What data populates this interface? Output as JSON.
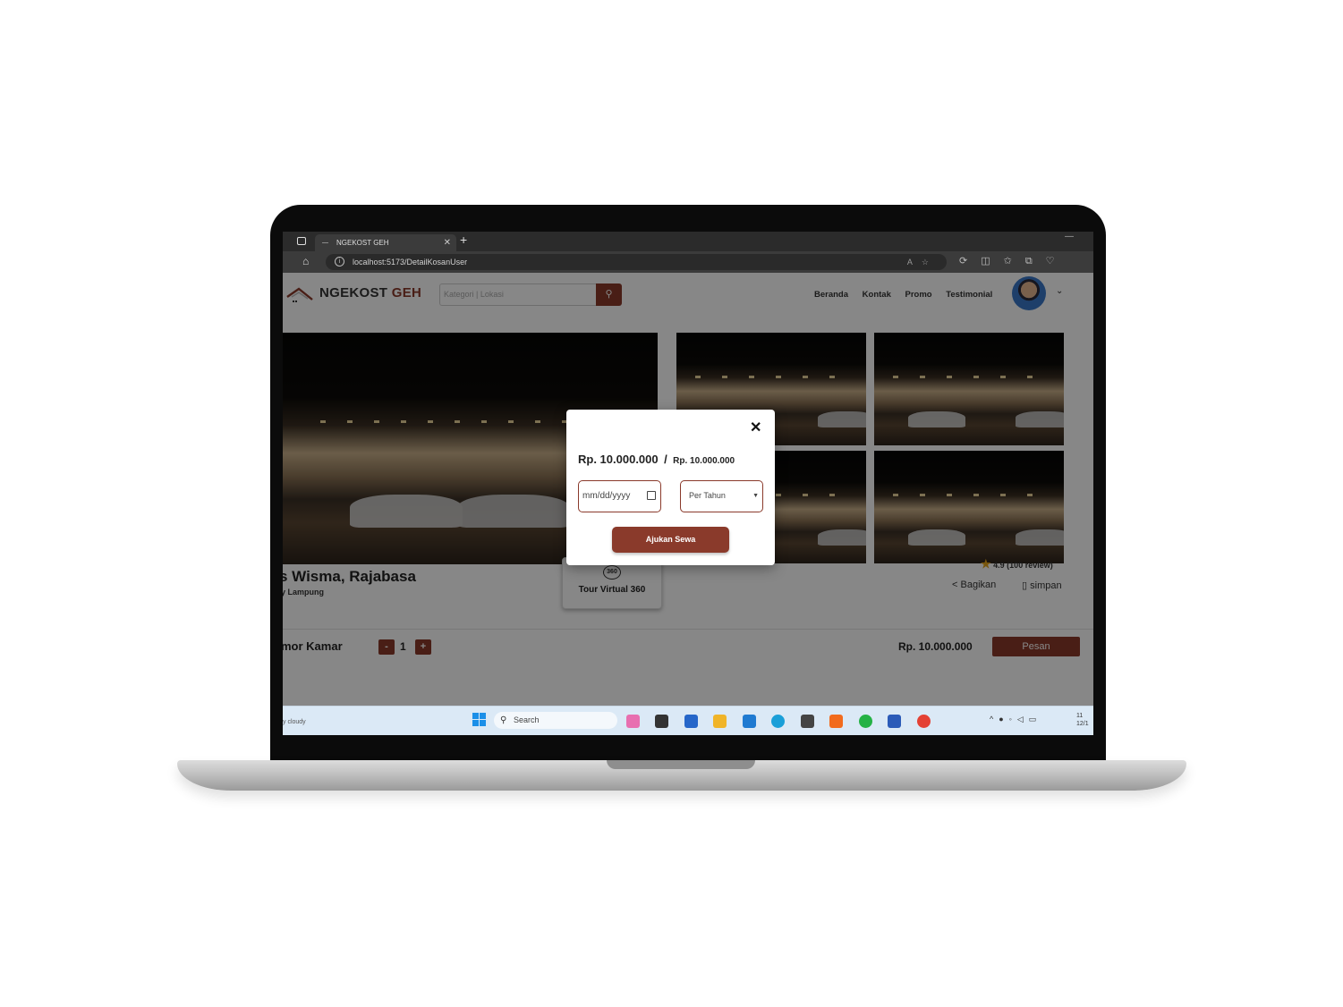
{
  "browser": {
    "tab_title": "NGEKOST GEH",
    "url": "localhost:5173/DetailKosanUser"
  },
  "site": {
    "logo_main": "NGEKOST",
    "logo_accent": "GEH",
    "search_placeholder": "Kategori  |  Lokasi",
    "nav": [
      "Beranda",
      "Kontak",
      "Promo",
      "Testimonial"
    ]
  },
  "listing": {
    "title": "s Wisma, Rajabasa",
    "location": "y Lampung",
    "tour_label": "Tour Virtual 360",
    "tour_icon_text": "360",
    "rating": "4.9 (100 review)",
    "share_label": "Bagikan",
    "save_label": "simpan",
    "room_label": "mor Kamar",
    "qty_minus": "-",
    "qty": "1",
    "qty_plus": "+",
    "price": "Rp. 10.000.000",
    "order_label": "Pesan"
  },
  "modal": {
    "price_main": "Rp. 10.000.000",
    "price_separator": "/",
    "price_sub": "Rp. 10.000.000",
    "date_placeholder": "mm/dd/yyyy",
    "period_selected": "Per Tahun",
    "submit_label": "Ajukan Sewa",
    "close_glyph": "✕"
  },
  "taskbar": {
    "weather": "y cloudy",
    "search_label": "Search",
    "clock_time": "11",
    "clock_date": "12/1"
  },
  "colors": {
    "brand": "#8a3a2b",
    "star": "#e3a21a"
  }
}
